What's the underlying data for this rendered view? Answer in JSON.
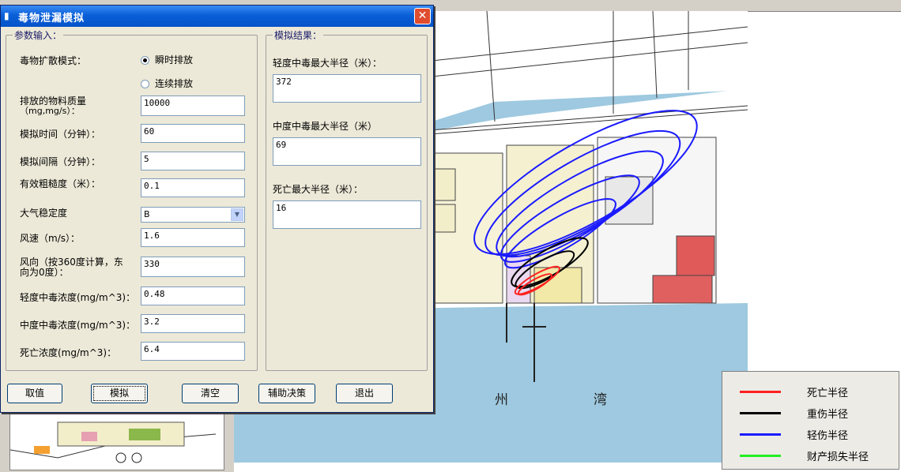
{
  "dialog": {
    "title": "毒物泄漏模拟",
    "close_icon": "close-icon",
    "input_group": {
      "title": "参数输入：",
      "diffusion_mode_label": "毒物扩散模式：",
      "mode_instant": "瞬时排放",
      "mode_continuous": "连续排放",
      "selected_mode": "瞬时排放",
      "mass_label_line1": "排放的物料质量",
      "mass_label_line2": "（mg,mg/s）：",
      "mass_value": "10000",
      "sim_time_label": "模拟时间（分钟）：",
      "sim_time_value": "60",
      "interval_label": "模拟间隔（分钟）：",
      "interval_value": "5",
      "roughness_label": "有效粗糙度（米）：",
      "roughness_value": "0.1",
      "stability_label": "大气稳定度",
      "stability_value": "B",
      "wind_speed_label": "风速（m/s）：",
      "wind_speed_value": "1.6",
      "wind_dir_label_line1": "风向（按360度计算，东",
      "wind_dir_label_line2": "向为0度）：",
      "wind_dir_value": "330",
      "light_conc_label": "轻度中毒浓度(mg/m^3)：",
      "light_conc_value": "0.48",
      "medium_conc_label": "中度中毒浓度(mg/m^3)：",
      "medium_conc_value": "3.2",
      "death_conc_label": "死亡浓度(mg/m^3)：",
      "death_conc_value": "6.4"
    },
    "result_group": {
      "title": "模拟结果：",
      "light_radius_label": "轻度中毒最大半径（米）：",
      "light_radius_value": "372",
      "medium_radius_label": "中度中毒最大半径（米）",
      "medium_radius_value": "69",
      "death_radius_label": "死亡最大半径（米）：",
      "death_radius_value": "16"
    },
    "buttons": {
      "get_value": "取值",
      "simulate": "模拟",
      "clear": "清空",
      "decision": "辅助决策",
      "exit": "退出"
    }
  },
  "map": {
    "labels": {
      "zhou": "州",
      "wan": "湾"
    },
    "colors": {
      "sea": "#9ec9e0",
      "land": "#ffffff",
      "plot_yellow": "#f5efc6",
      "plot_red": "#e05a5a",
      "plot_pink": "#e8a0b0"
    }
  },
  "legend": {
    "items": [
      {
        "label": "死亡半径",
        "color": "#ff2020"
      },
      {
        "label": "重伤半径",
        "color": "#000000"
      },
      {
        "label": "轻伤半径",
        "color": "#1a1aff"
      },
      {
        "label": "财产损失半径",
        "color": "#22ee22"
      }
    ]
  }
}
